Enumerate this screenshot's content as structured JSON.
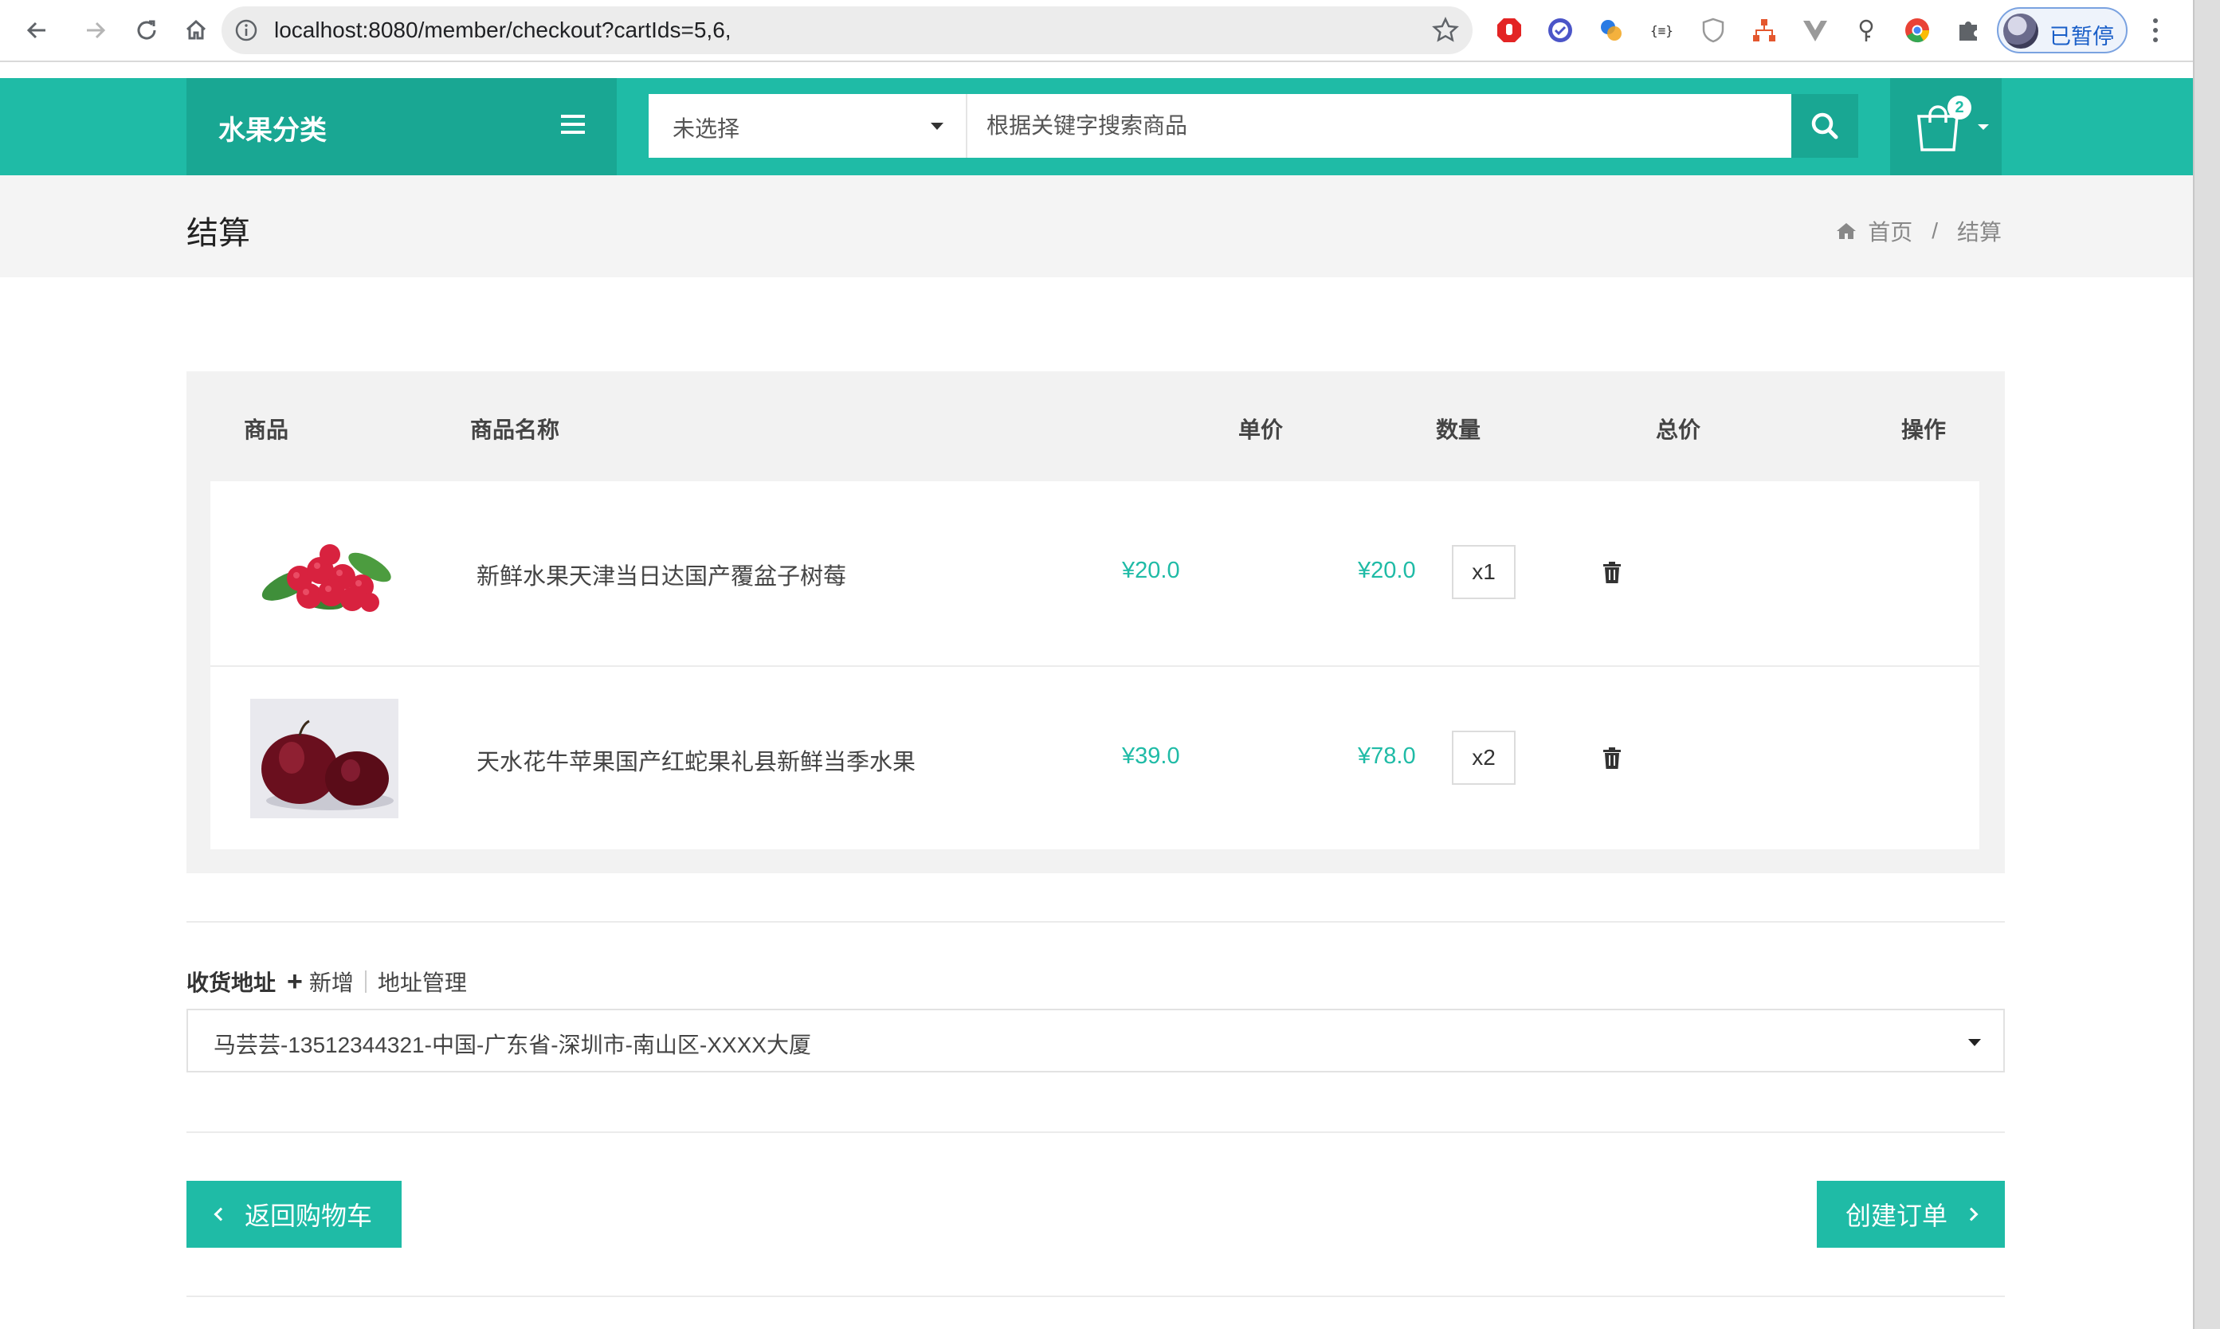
{
  "browser": {
    "url": "localhost:8080/member/checkout?cartIds=5,6,",
    "profile_label": "已暂停"
  },
  "header": {
    "category_title": "水果分类",
    "search_select_value": "未选择",
    "search_placeholder": "根据关键字搜索商品",
    "cart_count": "2",
    "accent_color": "#1fbba6",
    "accent_dark_color": "#19a793"
  },
  "page": {
    "title": "结算",
    "breadcrumb": {
      "home": "首页",
      "separator": "/",
      "current": "结算"
    }
  },
  "table": {
    "headers": {
      "product": "商品",
      "name": "商品名称",
      "unit_price": "单价",
      "quantity": "数量",
      "total": "总价",
      "action": "操作"
    },
    "rows": [
      {
        "image": "raspberry-image",
        "name": "新鲜水果天津当日达国产覆盆子树莓",
        "unit_price": "¥20.0",
        "quantity": "x1",
        "total": "¥20.0",
        "action_icon": "trash-icon"
      },
      {
        "image": "apple-image",
        "name": "天水花牛苹果国产红蛇果礼县新鲜当季水果",
        "unit_price": "¥39.0",
        "quantity": "x2",
        "total": "¥78.0",
        "action_icon": "trash-icon"
      }
    ]
  },
  "address": {
    "label": "收货地址",
    "add_label": "新增",
    "manage_label": "地址管理",
    "selected": "马芸芸-13512344321-中国-广东省-深圳市-南山区-XXXX大厦"
  },
  "actions": {
    "back_label": "返回购物车",
    "create_label": "创建订单"
  }
}
